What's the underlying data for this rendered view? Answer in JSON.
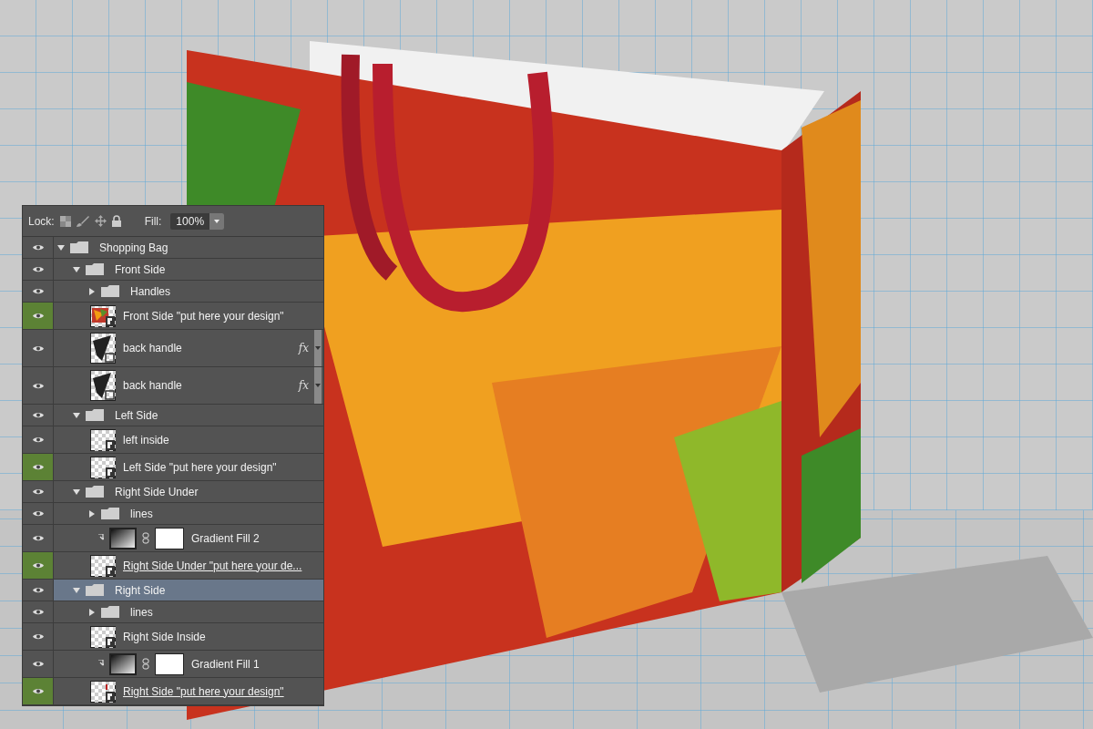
{
  "toolbar": {
    "lock_label": "Lock:",
    "fill_label": "Fill:",
    "fill_value": "100%"
  },
  "layers": [
    {
      "name": "Shopping Bag",
      "kind": "group",
      "expanded": true,
      "selected": false,
      "tagged": false,
      "underlined": false,
      "children": [
        {
          "name": "Front Side",
          "kind": "group",
          "expanded": true,
          "selected": false,
          "tagged": false,
          "underlined": false,
          "children": [
            {
              "name": "Handles",
              "kind": "group",
              "expanded": false,
              "selected": false,
              "tagged": false,
              "underlined": false
            },
            {
              "name": "Front Side \"put here your design\"",
              "kind": "smart",
              "artwork": true,
              "mark": false,
              "selected": false,
              "tagged": true,
              "underlined": false
            },
            {
              "name": "back handle",
              "kind": "shape",
              "fx": "fx",
              "selected": false,
              "tagged": false,
              "underlined": false
            },
            {
              "name": "back handle",
              "kind": "shape",
              "fx": "fx",
              "selected": false,
              "tagged": false,
              "underlined": false
            }
          ]
        },
        {
          "name": "Left Side",
          "kind": "group",
          "expanded": true,
          "selected": false,
          "tagged": false,
          "underlined": false,
          "children": [
            {
              "name": "left inside",
              "kind": "smart",
              "artwork": false,
              "mark": false,
              "selected": false,
              "tagged": false,
              "underlined": false
            },
            {
              "name": "Left Side \"put here your design\"",
              "kind": "smart",
              "artwork": false,
              "mark": false,
              "selected": false,
              "tagged": true,
              "underlined": false
            }
          ]
        },
        {
          "name": "Right Side Under",
          "kind": "group",
          "expanded": true,
          "selected": false,
          "tagged": false,
          "underlined": false,
          "children": [
            {
              "name": "lines",
              "kind": "group",
              "expanded": false,
              "selected": false,
              "tagged": false,
              "underlined": false
            },
            {
              "name": "Gradient Fill 2",
              "kind": "fill",
              "selected": false,
              "tagged": false,
              "underlined": false
            },
            {
              "name": "Right Side Under \"put here your de...",
              "kind": "smart",
              "artwork": false,
              "mark": false,
              "selected": false,
              "tagged": true,
              "underlined": true
            }
          ]
        },
        {
          "name": "Right Side",
          "kind": "group",
          "expanded": true,
          "selected": true,
          "tagged": false,
          "underlined": false,
          "children": [
            {
              "name": "lines",
              "kind": "group",
              "expanded": false,
              "selected": false,
              "tagged": false,
              "underlined": false
            },
            {
              "name": "Right Side Inside",
              "kind": "smart",
              "artwork": false,
              "mark": false,
              "selected": false,
              "tagged": false,
              "underlined": false
            },
            {
              "name": "Gradient Fill 1",
              "kind": "fill",
              "selected": false,
              "tagged": false,
              "underlined": false
            },
            {
              "name": "Right Side \"put here your design\"",
              "kind": "smart",
              "artwork": false,
              "mark": true,
              "selected": false,
              "tagged": true,
              "underlined": true
            }
          ]
        }
      ]
    }
  ]
}
